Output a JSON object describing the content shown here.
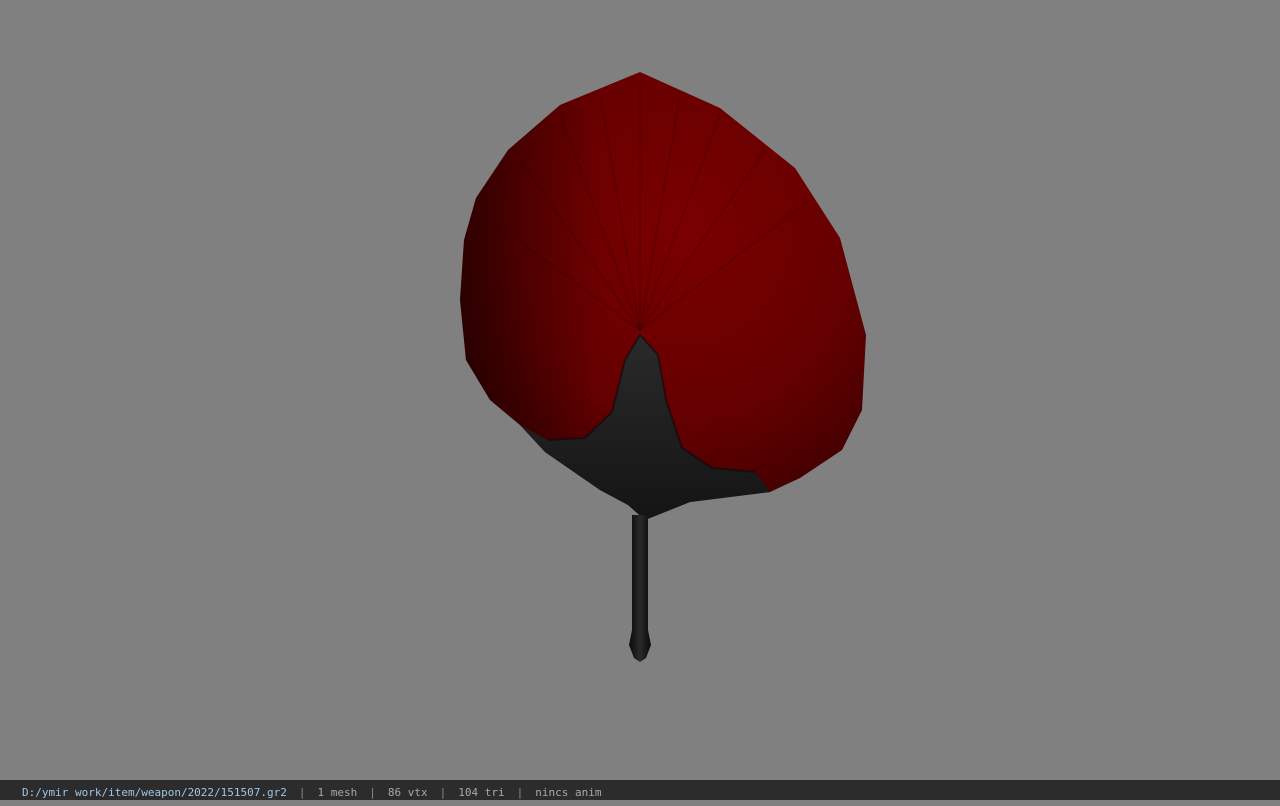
{
  "viewport": {
    "background_color": "#808080",
    "model": {
      "object": "red-hand-fan",
      "colors": {
        "leaf_red": "#6e0000",
        "leaf_red_dark": "#3a0000",
        "frame_dark": "#1c1c1c",
        "handle": "#151515"
      }
    }
  },
  "status_bar": {
    "file_path": "D:/ymir work/item/weapon/2022/151507.gr2",
    "separator": "|",
    "mesh_count": "1 mesh",
    "vertex_count": "86 vtx",
    "triangle_count": "104 tri",
    "animation": "nincs anim"
  }
}
